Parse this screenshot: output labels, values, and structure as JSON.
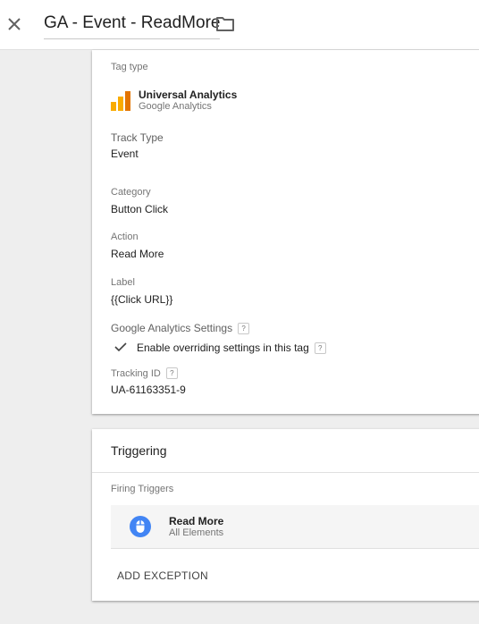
{
  "header": {
    "title": "GA - Event - ReadMore",
    "close_icon": "close-icon",
    "folder_icon": "folder-icon"
  },
  "tag_config": {
    "tag_type_label": "Tag type",
    "tag_type_name": "Universal Analytics",
    "tag_type_vendor": "Google Analytics",
    "track_type_label": "Track Type",
    "track_type_value": "Event",
    "category_label": "Category",
    "category_value": "Button Click",
    "action_label": "Action",
    "action_value": "Read More",
    "label_label": "Label",
    "label_value": "{{Click URL}}",
    "ga_settings_label": "Google Analytics Settings",
    "override_label": "Enable overriding settings in this tag",
    "override_checked": true,
    "tracking_id_label": "Tracking ID",
    "tracking_id_value": "UA-61163351-9",
    "help_glyph": "?"
  },
  "triggering": {
    "title": "Triggering",
    "firing_label": "Firing Triggers",
    "triggers": [
      {
        "name": "Read More",
        "type": "All Elements",
        "icon": "mouse-icon"
      }
    ],
    "add_exception_label": "ADD EXCEPTION"
  },
  "colors": {
    "ua_logo_orange": "#f9ab00",
    "ua_logo_dark": "#e37400",
    "trigger_icon_blue": "#4285f4",
    "page_bg": "#eeeeee"
  }
}
